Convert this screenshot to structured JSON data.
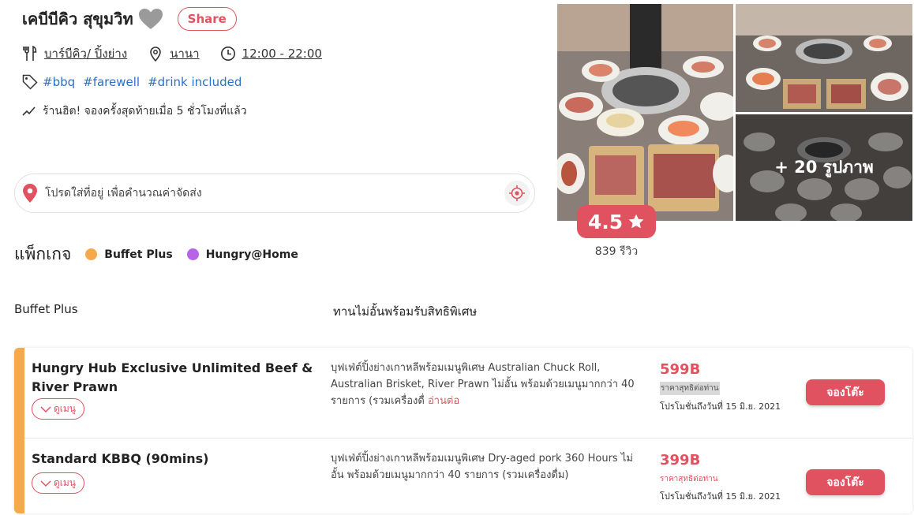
{
  "restaurant": {
    "name": "เคบีบีคิว สุขุมวิท",
    "share_label": "Share",
    "cuisine": "บาร์บีคิว/ ปิ้งย่าง",
    "location": "นานา",
    "hours": "12:00 - 22:00",
    "tags": [
      "#bbq",
      "#farewell",
      "#drink included"
    ],
    "hot_text": "ร้านฮิต! จองครั้งสุดท้ายเมื่อ 5 ชั่วโมงที่แล้ว"
  },
  "address": {
    "placeholder": "โปรดใส่ที่อยู่ เพื่อคำนวณค่าจัดส่ง"
  },
  "packages_header": {
    "title": "แพ็กเกจ",
    "legend": [
      {
        "label": "Buffet Plus",
        "color": "#f5a94a"
      },
      {
        "label": "Hungry@Home",
        "color": "#b862e8"
      }
    ]
  },
  "gallery": {
    "more_photos": "+ 20 รูปภาพ"
  },
  "rating": {
    "score": "4.5",
    "reviews": "839 รีวิว"
  },
  "section": {
    "type": "Buffet Plus",
    "description": "ทานไม่อั้นพร้อมรับสิทธิพิเศษ"
  },
  "package_items": [
    {
      "name": "Hungry Hub Exclusive Unlimited Beef & River Prawn",
      "menu_label": "ดูเมนู",
      "description": "บุฟเฟ่ต์ปิ้งย่างเกาหลีพร้อมเมนูพิเศษ Australian Chuck Roll, Australian Brisket, River Prawn ไม่อั้น พร้อมด้วยเมนูมากกว่า 40 รายการ (รวมเครื่องดื่",
      "read_more": "อ่านต่อ",
      "price": "599B",
      "price_note": "ราคาสุทธิต่อท่าน",
      "promo": "โปรโมชั่นถึงวันที่ 15 มิ.ย. 2021",
      "book_label": "จองโต๊ะ"
    },
    {
      "name": "Standard KBBQ (90mins)",
      "menu_label": "ดูเมนู",
      "description": "บุฟเฟ่ต์ปิ้งย่างเกาหลีพร้อมเมนูพิเศษ Dry-aged pork 360 Hours ไม่อั้น พร้อมด้วยเมนูมากกว่า 40 รายการ (รวมเครื่องดื่ม)",
      "price": "399B",
      "price_note": "ราคาสุทธิต่อท่าน",
      "promo": "โปรโมชั่นถึงวันที่ 15 มิ.ย. 2021",
      "book_label": "จองโต๊ะ"
    }
  ],
  "colors": {
    "accent": "#e0525f",
    "buffet_plus": "#f5a94a",
    "hungry_home": "#b862e8",
    "link": "#2d6ec8"
  }
}
